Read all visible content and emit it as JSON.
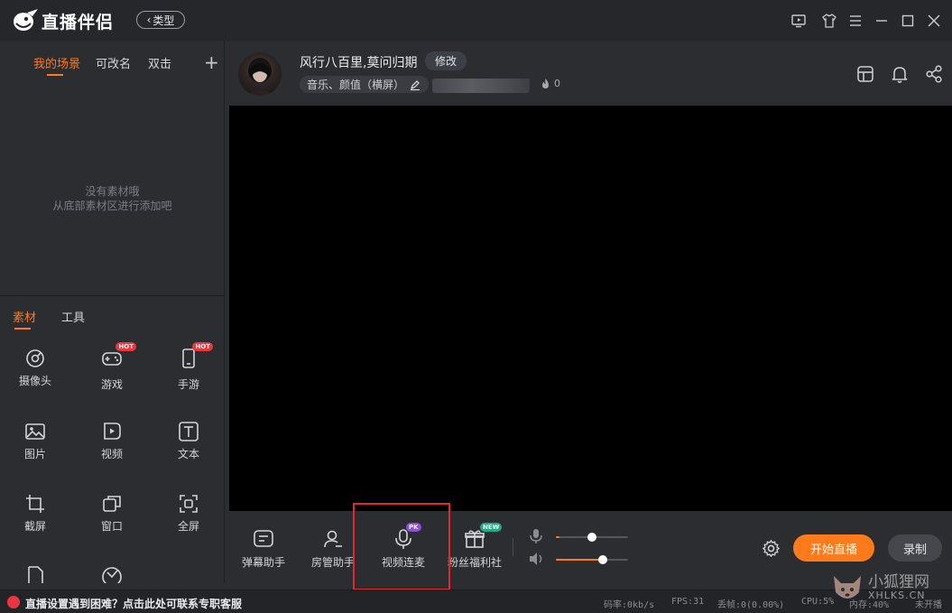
{
  "app": {
    "title": "直播伴侣",
    "type_button": "类型"
  },
  "scenes": {
    "tabs": [
      "我的场景",
      "可改名",
      "双击"
    ],
    "add_label": "+",
    "empty_line1": "没有素材哦",
    "empty_line2": "从底部素材区进行添加吧"
  },
  "materials": {
    "tabs": [
      "素材",
      "工具"
    ],
    "items": [
      {
        "label": "摄像头",
        "icon": "camera-icon"
      },
      {
        "label": "游戏",
        "icon": "gamepad-icon",
        "badge": "HOT"
      },
      {
        "label": "手游",
        "icon": "phone-icon",
        "badge": "HOT"
      },
      {
        "label": "图片",
        "icon": "image-icon"
      },
      {
        "label": "视频",
        "icon": "video-icon"
      },
      {
        "label": "文本",
        "icon": "text-icon"
      },
      {
        "label": "截屏",
        "icon": "crop-icon"
      },
      {
        "label": "窗口",
        "icon": "window-icon"
      },
      {
        "label": "全屏",
        "icon": "fullscreen-icon"
      }
    ]
  },
  "room": {
    "title": "风行八百里,莫问归期",
    "edit_label": "修改",
    "category": "音乐、颜值（横屏）",
    "heat_count": "0"
  },
  "toolbar": {
    "items": [
      {
        "label": "弹幕助手",
        "icon": "danmaku-icon"
      },
      {
        "label": "房管助手",
        "icon": "room-manager-icon"
      },
      {
        "label": "视频连麦",
        "icon": "mic-link-icon",
        "badge": "PK"
      },
      {
        "label": "粉丝福利社",
        "icon": "gift-icon",
        "badge": "NEW"
      }
    ],
    "mic_level": 0.5,
    "speaker_level": 0.65,
    "start_label": "开始直播",
    "record_label": "录制"
  },
  "status": {
    "help_text": "直播设置遇到困难？点击此处可联系专职客服",
    "bitrate": "码率:0kb/s",
    "fps": "FPS:31",
    "dropped": "丢帧:0(0.00%)",
    "cpu": "CPU:5%",
    "memory": "内存:40%",
    "state": "未开播"
  },
  "watermark": {
    "text": "小狐狸网",
    "sub": "XHLKS.CN"
  },
  "colors": {
    "accent": "#ff7a1a",
    "background": "#2b2d31",
    "preview": "#000000",
    "highlight": "#e0282e"
  }
}
